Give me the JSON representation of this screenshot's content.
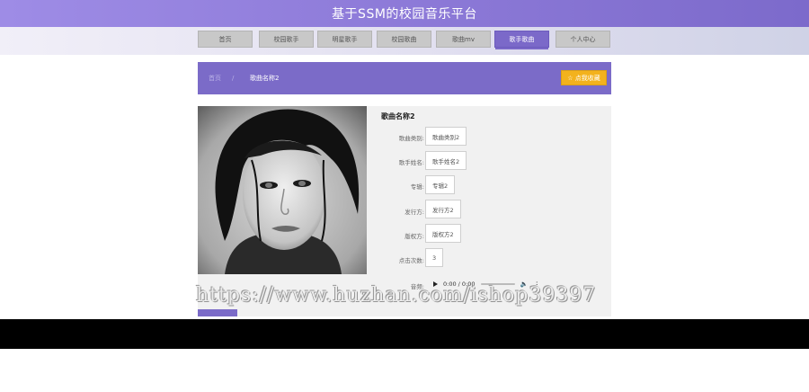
{
  "header": {
    "title": "基于SSM的校园音乐平台"
  },
  "nav": {
    "items": [
      {
        "label": "首页"
      },
      {
        "label": "校园歌手"
      },
      {
        "label": "明星歌手"
      },
      {
        "label": "校园歌曲"
      },
      {
        "label": "歌曲mv"
      },
      {
        "label": "歌手歌曲",
        "active": true
      },
      {
        "label": "个人中心"
      }
    ]
  },
  "breadcrumb": {
    "home": "首页",
    "separator": "/",
    "current": "歌曲名称2"
  },
  "favorite_button": {
    "label": "☆ 点我收藏"
  },
  "song": {
    "title": "歌曲名称2",
    "fields": [
      {
        "label": "歌曲类别:",
        "value": "歌曲类别2"
      },
      {
        "label": "歌手姓名:",
        "value": "歌手姓名2"
      },
      {
        "label": "专辑:",
        "value": "专辑2"
      },
      {
        "label": "发行方:",
        "value": "发行方2"
      },
      {
        "label": "版权方:",
        "value": "版权方2"
      },
      {
        "label": "点击次数:",
        "value": "3"
      }
    ],
    "audio": {
      "label": "音频:",
      "time": "0:00 / 0:00"
    }
  },
  "watermark": "https://www.huzhan.com/ishop39397",
  "colors": {
    "brand_purple": "#7b6bc8",
    "favorite_yellow": "#f3b21d"
  },
  "icons": {
    "play": "play-icon",
    "volume": "volume-icon",
    "menu": "more-vertical-icon"
  }
}
